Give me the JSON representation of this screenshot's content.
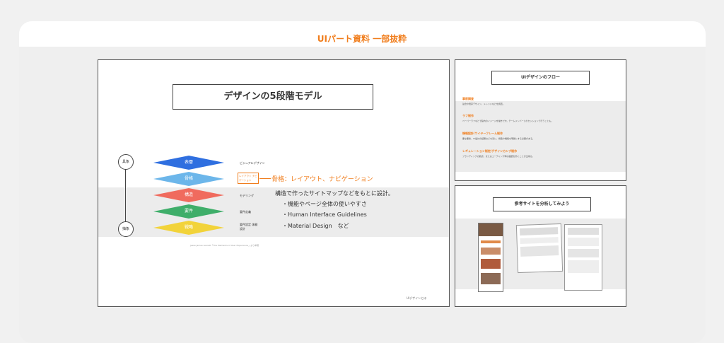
{
  "header": {
    "title": "UIパート資料 一部抜粋"
  },
  "slide1": {
    "title": "デザインの5段階モデル",
    "top_label": "具象",
    "bottom_label": "抽象",
    "layers": [
      {
        "name": "表層",
        "label": "ビジュアルデザイン",
        "color": "#2f6fe0"
      },
      {
        "name": "骨格",
        "label": "レイアウト ナビゲーション",
        "color": "#6cb6ea"
      },
      {
        "name": "構造",
        "label": "モデリング",
        "color": "#f06b5e"
      },
      {
        "name": "要件",
        "label": "要件定義",
        "color": "#3fae6a"
      },
      {
        "name": "戦略",
        "label": "要件設定 体験設計",
        "color": "#f2d33a"
      }
    ],
    "highlight": "骨格：レイアウト、ナビゲーション",
    "description": "構造で作ったサイトマップなどをもとに設計。",
    "bullets": [
      "・機能やページ全体の使いやすさ",
      "・Human Interface Guidelines",
      "・Material Design　など"
    ],
    "caption": "Jesse James Garrett「The Elements of User Experience」より参照",
    "footer_right": "UIデザインとは"
  },
  "slide2": {
    "title": "UIデザインのフロー",
    "steps": [
      {
        "heading": "事前調査",
        "desc": "競合や既存デザイン、トレンドなどを調査。"
      },
      {
        "heading": "ラフ制作",
        "desc": "ペーパーラフなどで脳内のイメージを描きだす。チームメンバーとのセッションで行うことも。"
      },
      {
        "heading": "情報設計/ワイヤーフレーム制作",
        "desc": "要な要素、UI設計の結果などを基に、構造や機能を明確にする必要がある。"
      },
      {
        "heading": "レギュレーション制定/デザインカンプ制作",
        "desc": "ブランディングの観点、またはコーディング時の齟齬を防ぐことが出来る。"
      }
    ]
  },
  "slide3": {
    "title": "参考サイトを分析してみよう"
  }
}
